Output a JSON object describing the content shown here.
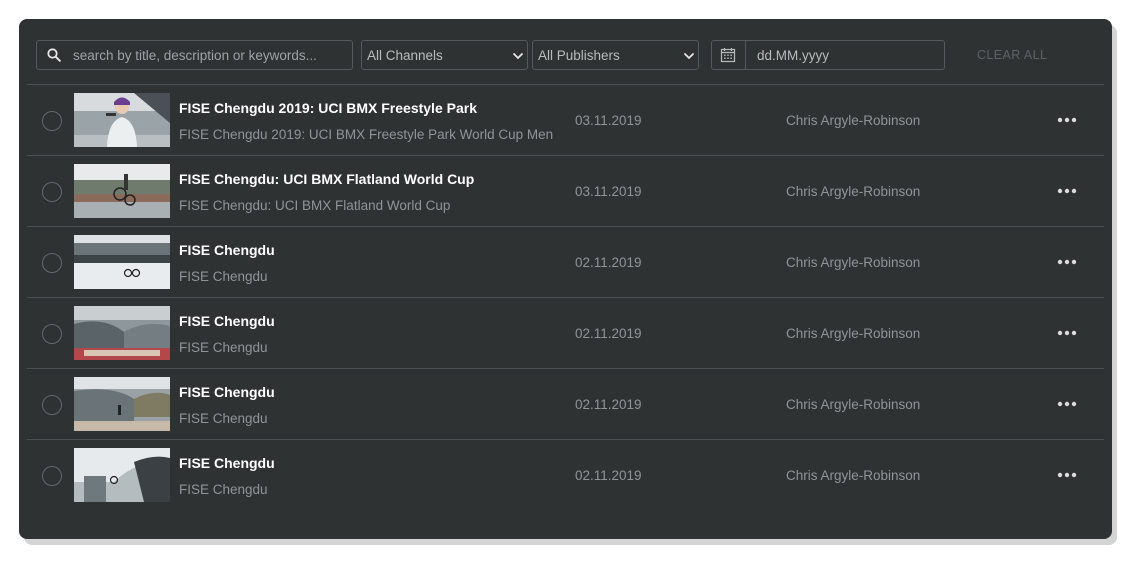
{
  "filters": {
    "search_placeholder": "search by title, description or keywords...",
    "channel_select": "All Channels",
    "publisher_select": "All Publishers",
    "date_value": "dd.MM.yyyy",
    "clear_label": "CLEAR ALL"
  },
  "videos": [
    {
      "title": "FISE Chengdu 2019: UCI BMX Freestyle Park …",
      "description": "FISE Chengdu 2019: UCI BMX Freestyle Park World Cup Men",
      "date": "03.11.2019",
      "publisher": "Chris Argyle-Robinson"
    },
    {
      "title": "FISE Chengdu: UCI BMX Flatland World Cup",
      "description": "FISE Chengdu: UCI BMX Flatland World Cup",
      "date": "03.11.2019",
      "publisher": "Chris Argyle-Robinson"
    },
    {
      "title": "FISE Chengdu",
      "description": "FISE Chengdu",
      "date": "02.11.2019",
      "publisher": "Chris Argyle-Robinson"
    },
    {
      "title": "FISE Chengdu",
      "description": "FISE Chengdu",
      "date": "02.11.2019",
      "publisher": "Chris Argyle-Robinson"
    },
    {
      "title": "FISE Chengdu",
      "description": "FISE Chengdu",
      "date": "02.11.2019",
      "publisher": "Chris Argyle-Robinson"
    },
    {
      "title": "FISE Chengdu",
      "description": "FISE Chengdu",
      "date": "02.11.2019",
      "publisher": "Chris Argyle-Robinson"
    }
  ],
  "icons": {
    "search": "search-icon",
    "dropdown": "chevron-down-icon",
    "calendar": "calendar-icon",
    "row_menu": "more-horizontal-icon"
  },
  "colors": {
    "panel_bg": "#2f3233",
    "text_primary": "#ffffff",
    "text_secondary": "#8f9496",
    "border": "#55595b",
    "clear_disabled": "#5c6163"
  }
}
